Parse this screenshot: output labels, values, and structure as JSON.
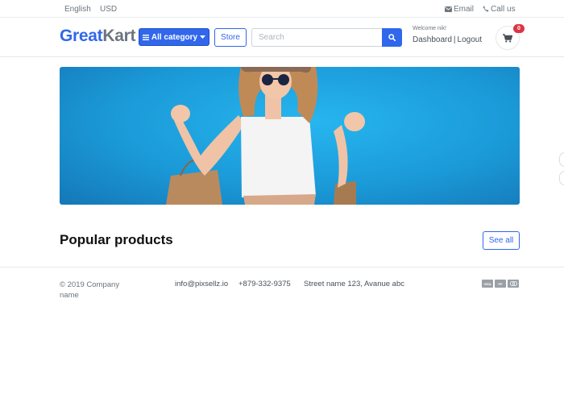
{
  "topbar": {
    "language": "English",
    "currency": "USD",
    "email_label": "Email",
    "call_label": "Call us"
  },
  "header": {
    "logo_part1": "Great",
    "logo_part2": "Kart",
    "category_label": "All category",
    "store_label": "Store",
    "search_placeholder": "Search",
    "welcome_text": "Welcome nik!",
    "dashboard_label": "Dashboard",
    "logout_label": "Logout",
    "cart_count": "0"
  },
  "main": {
    "section_title": "Popular products",
    "see_all_label": "See all"
  },
  "footer": {
    "copyright": "© 2019 Company name",
    "email": "info@pixsellz.io",
    "phone": "+879-332-9375",
    "address": "Street name 123, Avanue abc",
    "payment_icons": [
      "visa-icon",
      "paypal-icon",
      "mastercard-icon"
    ]
  },
  "colors": {
    "primary": "#3167eb",
    "badge": "#dc3545",
    "banner": "#1b9ad8"
  }
}
